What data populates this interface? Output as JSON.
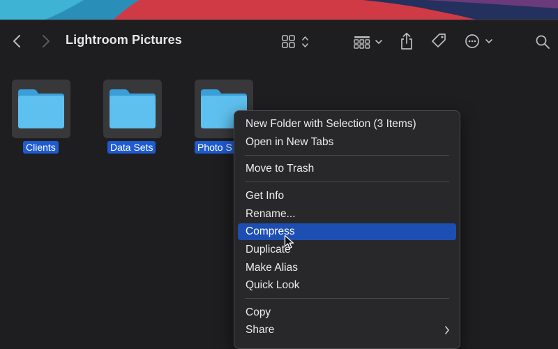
{
  "window": {
    "title": "Lightroom Pictures"
  },
  "toolbar": {
    "back": "chevron-left-icon",
    "forward": "chevron-right-icon",
    "view": "grid-view-icon",
    "group": "group-by-icon",
    "share": "share-icon",
    "tags": "tag-icon",
    "more": "ellipsis-circle-icon",
    "search": "search-icon"
  },
  "folders": [
    {
      "label": "Clients"
    },
    {
      "label": "Data Sets"
    },
    {
      "label": "Photo S"
    }
  ],
  "context_menu": {
    "items": [
      "New Folder with Selection (3 Items)",
      "Open in New Tabs",
      "Move to Trash",
      "Get Info",
      "Rename...",
      "Compress",
      "Duplicate",
      "Make Alias",
      "Quick Look",
      "Copy",
      "Share"
    ],
    "highlighted": "Compress"
  },
  "colors": {
    "window_bg": "#1e1e20",
    "menu_bg": "#28282b",
    "selection": "#1f5bd0",
    "highlight": "#1d4fb3",
    "folder": "#52b8ec"
  }
}
